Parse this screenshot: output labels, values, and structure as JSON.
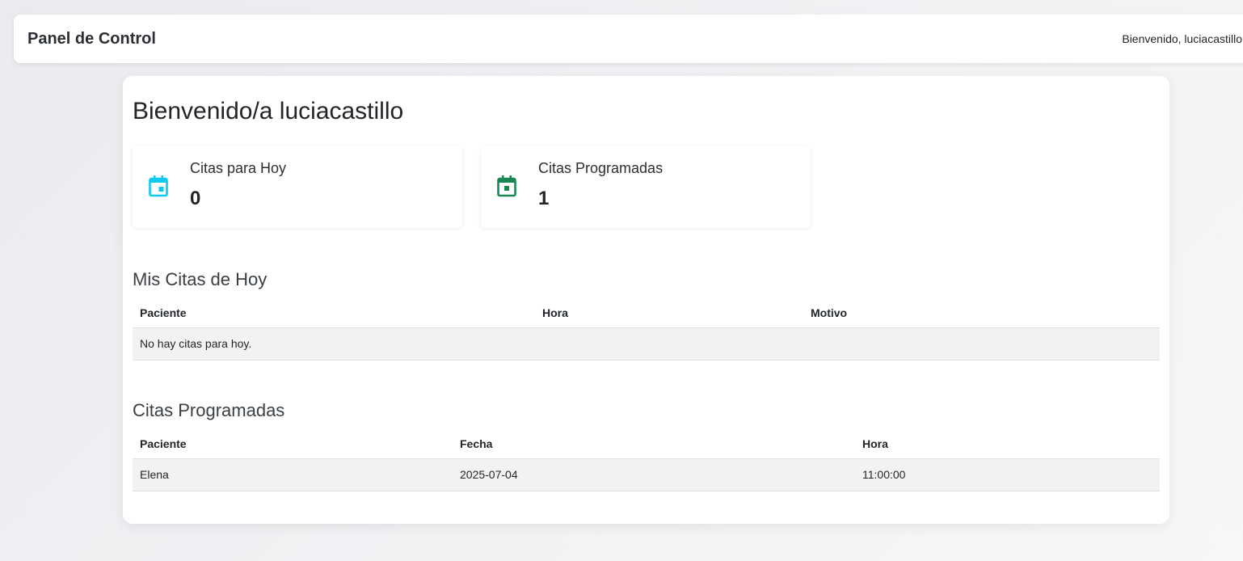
{
  "navbar": {
    "brand": "Panel de Control",
    "welcome": "Bienvenido, luciacastillo"
  },
  "page": {
    "title": "Bienvenido/a luciacastillo"
  },
  "stats": [
    {
      "label": "Citas para Hoy",
      "value": "0",
      "icon": "calendar-icon",
      "color": "#0dcaf0"
    },
    {
      "label": "Citas Programadas",
      "value": "1",
      "icon": "calendar-icon",
      "color": "#198754"
    }
  ],
  "today": {
    "title": "Mis Citas de Hoy",
    "columns": [
      "Paciente",
      "Hora",
      "Motivo"
    ],
    "empty_message": "No hay citas para hoy."
  },
  "scheduled": {
    "title": "Citas Programadas",
    "columns": [
      "Paciente",
      "Fecha",
      "Hora"
    ],
    "rows": [
      {
        "paciente": "Elena",
        "fecha": "2025-07-04",
        "hora": "11:00:00"
      }
    ]
  }
}
